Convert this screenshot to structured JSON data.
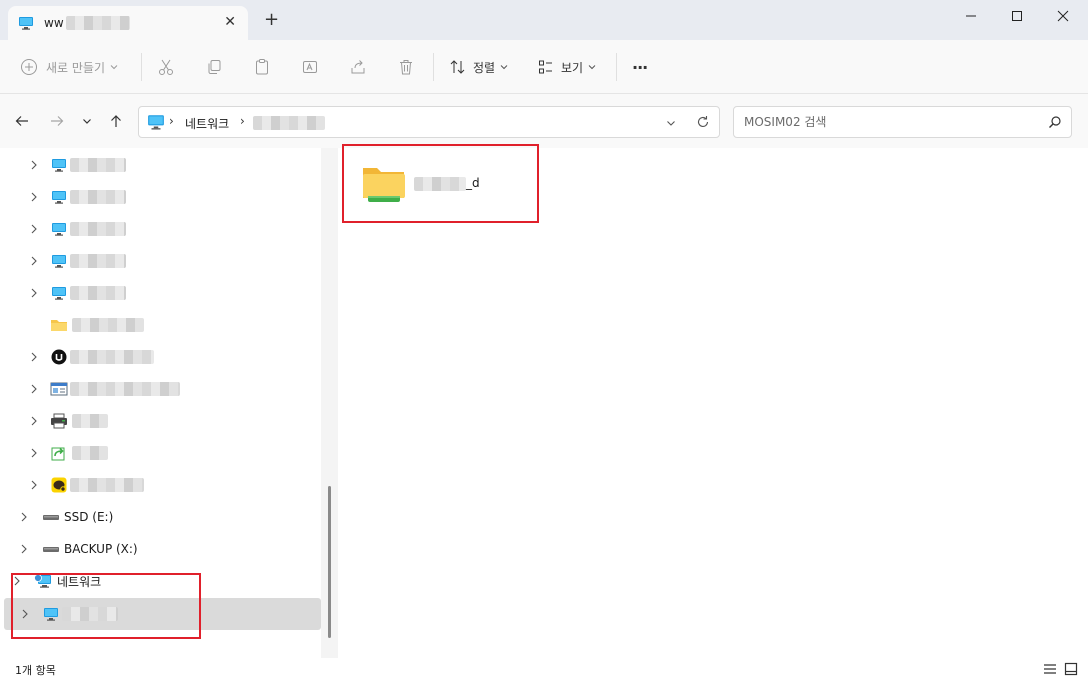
{
  "window": {
    "tab_title": "ww",
    "new_tab_symbol": "+",
    "tab_close_symbol": "✕"
  },
  "toolbar": {
    "new_label": "새로 만들기",
    "sort_label": "정렬",
    "view_label": "보기",
    "more_label": "···"
  },
  "address": {
    "root": "네트워크",
    "separator": "›"
  },
  "search": {
    "placeholder": "MOSIM02 검색"
  },
  "navpane": {
    "drive_e": "SSD (E:)",
    "drive_x": "BACKUP (X:)",
    "network": "네트워크"
  },
  "content": {
    "folder_suffix": "_d"
  },
  "status": {
    "item_count": "1개 항목"
  },
  "colors": {
    "accent_red": "#e0202b",
    "folder_yellow": "#f6c64a",
    "share_green": "#3fae49",
    "monitor_blue": "#1f9be0"
  }
}
